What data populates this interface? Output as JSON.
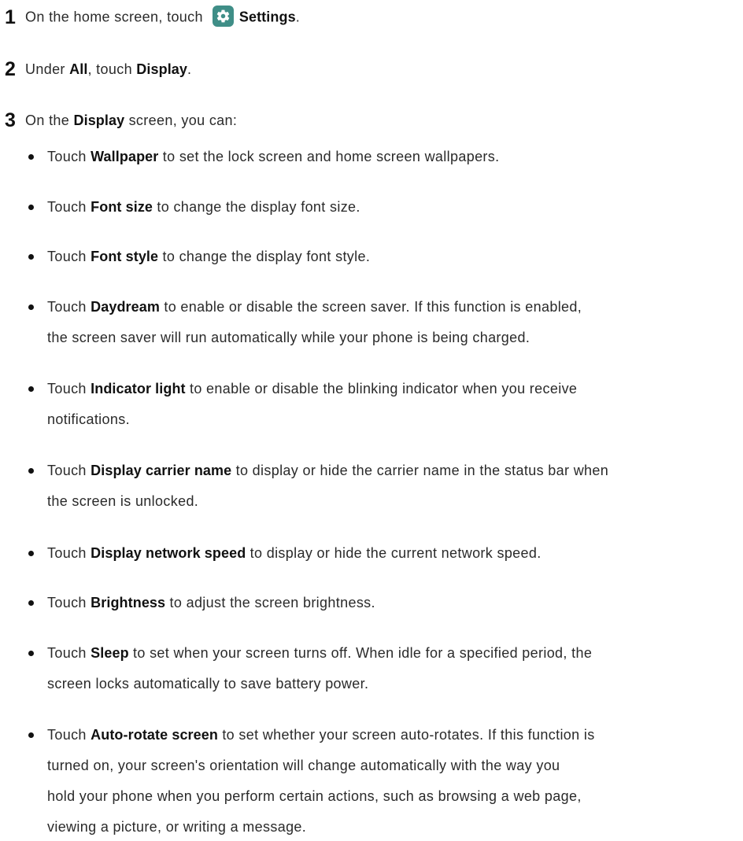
{
  "steps": [
    {
      "num": "1",
      "pre": "On the home screen, touch",
      "icon": "settings-gear-icon",
      "bold": "Settings",
      "post": "."
    },
    {
      "num": "2",
      "pre": "Under ",
      "bold1": "All",
      "mid": ", touch ",
      "bold2": "Display",
      "post": "."
    },
    {
      "num": "3",
      "pre": "On the ",
      "bold": "Display",
      "post": " screen, you can:"
    }
  ],
  "bullets": [
    {
      "pre": "Touch ",
      "bold": "Wallpaper",
      "lines": [
        " to set the lock screen and home screen wallpapers."
      ]
    },
    {
      "pre": "Touch ",
      "bold": "Font size",
      "lines": [
        " to change the display font size."
      ]
    },
    {
      "pre": "Touch ",
      "bold": "Font style",
      "lines": [
        " to change the display font style."
      ]
    },
    {
      "pre": "Touch ",
      "bold": "Daydream",
      "lines": [
        " to enable or disable the screen saver. If this function is enabled,",
        "the screen saver will run automatically while your phone is being charged."
      ]
    },
    {
      "pre": "Touch ",
      "bold": "Indicator light",
      "lines": [
        " to enable or disable the blinking indicator when you receive",
        "notifications."
      ]
    },
    {
      "pre": "Touch ",
      "bold": "Display carrier name",
      "lines": [
        " to display or hide the carrier name in the status bar when",
        "the screen is unlocked."
      ]
    },
    {
      "pre": "Touch ",
      "bold": "Display network speed",
      "lines": [
        " to display or hide the current network speed."
      ]
    },
    {
      "pre": "Touch ",
      "bold": "Brightness",
      "lines": [
        " to adjust the screen brightness."
      ]
    },
    {
      "pre": "Touch ",
      "bold": "Sleep",
      "lines": [
        " to set when your screen turns off. When idle for a specified period, the",
        "screen locks automatically to save battery power."
      ]
    },
    {
      "pre": "Touch ",
      "bold": "Auto-rotate screen",
      "lines": [
        " to set whether your screen auto-rotates. If this function is",
        "turned on, your screen's orientation will change automatically with the way you",
        "hold your phone when you perform certain actions, such as browsing a web page,",
        "viewing a picture, or writing a message."
      ]
    }
  ],
  "colors": {
    "settings_icon_bg": "#3f8e87",
    "text": "#2a2a2a"
  }
}
